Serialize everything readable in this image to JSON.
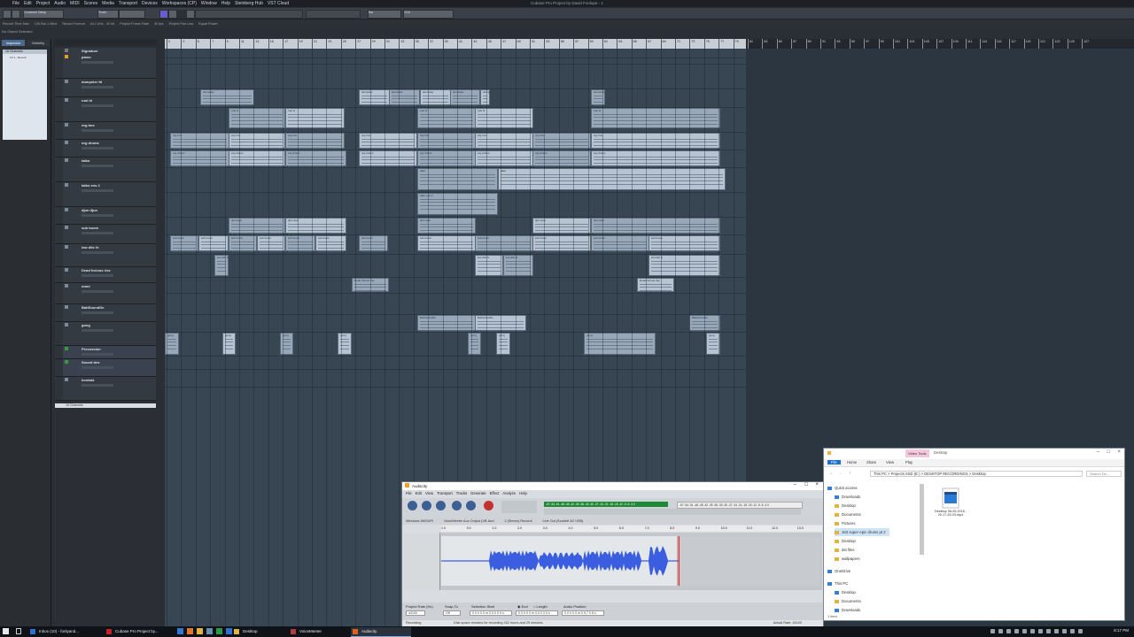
{
  "cubase": {
    "window_title": "Cubase Pro Project by David Fonlupe - 1",
    "menu": [
      "File",
      "Edit",
      "Project",
      "Audio",
      "MIDI",
      "Scores",
      "Media",
      "Transport",
      "Devices",
      "Workspaces (CP)",
      "Window",
      "Help",
      "Steinberg Hub",
      "VST Cloud"
    ],
    "toolbar": {
      "constrain": "Constrain Delay",
      "touch": "Touch",
      "grid": "Bar",
      "quantize": "1/16"
    },
    "infoline": [
      "Record Time Max",
      "126 Bar 1 Mins",
      "Record Format",
      "44.1 kHz - 32 bit",
      "Project Frame Rate",
      "30 fps",
      "Project Pan Law",
      "Equal Power"
    ],
    "selection_info": "No Object Selected",
    "inspector_tabs": [
      "Inspector",
      "Visibility"
    ],
    "inspector_heading": "16 Channels",
    "inspector_row": "FX 1 - Reverb",
    "channels_row": "16 Channels",
    "tracks": [
      {
        "name": "Signature",
        "color": "#7a7a7a"
      },
      {
        "name": "piano",
        "color": "#e0a020"
      },
      {
        "name": "dumpster fd",
        "color": "#7a8a9a"
      },
      {
        "name": "rust hi",
        "color": "#7a8a9a"
      },
      {
        "name": "org tms",
        "color": "#7a8a9a"
      },
      {
        "name": "org drums",
        "color": "#7a8a9a"
      },
      {
        "name": "taiko",
        "color": "#7a8a9a"
      },
      {
        "name": "taiko ens 2",
        "color": "#7a8a9a"
      },
      {
        "name": "djun djun",
        "color": "#7a8a9a"
      },
      {
        "name": "sub boom",
        "color": "#7a8a9a"
      },
      {
        "name": "low dtlc fx",
        "color": "#7a8a9a"
      },
      {
        "name": "Dead furious rise",
        "color": "#7a8a9a"
      },
      {
        "name": "omni",
        "color": "#7a8a9a"
      },
      {
        "name": "BattSoundDe",
        "color": "#7a8a9a"
      },
      {
        "name": "gong",
        "color": "#7a8a9a"
      },
      {
        "name": "Percussion",
        "color": "#3a9a40"
      },
      {
        "name": "Sound des",
        "color": "#3a9a40"
      },
      {
        "name": "kontakt",
        "color": "#7a8a9a"
      }
    ],
    "ruler_bars": [
      "1",
      "3",
      "5",
      "7",
      "9",
      "11",
      "13",
      "15",
      "17",
      "19",
      "21",
      "23",
      "25",
      "27",
      "29",
      "31",
      "33",
      "35",
      "37",
      "39",
      "41",
      "43",
      "45",
      "47",
      "49",
      "51",
      "53",
      "55",
      "57",
      "59",
      "61",
      "63",
      "65",
      "67",
      "69",
      "71",
      "73",
      "75",
      "77",
      "79"
    ],
    "ruler_bars_end": [
      "81",
      "83",
      "85",
      "87",
      "89",
      "91",
      "93",
      "95",
      "97",
      "99",
      "101",
      "103",
      "105",
      "107",
      "109",
      "111",
      "113",
      "115",
      "117",
      "119",
      "121",
      "123",
      "125",
      "127"
    ],
    "clips": [
      {
        "track": 2,
        "x0": "dumpster",
        "label": "dumpster"
      },
      {
        "track": 3,
        "label": "rust hi"
      },
      {
        "track": 4,
        "label": "org tms"
      },
      {
        "track": 5,
        "label": "org drums"
      },
      {
        "track": 6,
        "label": "taiko"
      },
      {
        "track": 7,
        "label": "taiko ens 2"
      },
      {
        "track": 8,
        "label": "djun djun"
      },
      {
        "track": 9,
        "label": "sub boom"
      },
      {
        "track": 10,
        "label": "low dtlc fx"
      },
      {
        "track": 11,
        "label": "Dead furious rise"
      },
      {
        "track": 13,
        "label": "BattSoundDe"
      },
      {
        "track": 14,
        "label": "gong"
      }
    ]
  },
  "audacity": {
    "title": "Audacity",
    "menu": [
      "File",
      "Edit",
      "View",
      "Transport",
      "Tracks",
      "Generate",
      "Effect",
      "Analyze",
      "Help"
    ],
    "meter_rec": "-57 -54 -51 -48 -45 -42 -39 -36 -33 -30 -27 -24 -21 -18 -15 -12 -9 -6 -3 0",
    "meter_play": "-57 -54 -51 -48 -45 -42 -39 -36 -33 -30 -27 -24 -21 -18 -15 -12 -9 -6 -3 0",
    "devices": [
      "Windows WASAPI",
      "VoiceMeeter Aux Output (VB-Aud",
      "2 (Stereo) Recordi",
      "Line Out (Scarlett 2i2 USB)"
    ],
    "ruler": [
      "1.0",
      "0.0",
      "1.0",
      "2.0",
      "3.0",
      "4.0",
      "5.0",
      "6.0",
      "7.0",
      "8.0",
      "9.0",
      "10.0",
      "11.0",
      "12.0",
      "13.0",
      "14.0",
      "15.0",
      "16.0"
    ],
    "project_rate_label": "Project Rate (Hz)",
    "project_rate": "44100",
    "snap_label": "Snap-To",
    "snap": "Off",
    "selection_start_label": "Selection Start",
    "selection_start": "0 0 h 0 0 m 0 0.0 0 0 s",
    "end_label": "End",
    "length_label": "Length",
    "selection_end": "0 0 h 0 0 m 0 0.0 0 0 s",
    "audio_position_label": "Audio Position",
    "audio_position": "0 0 h 0 0 m 0 9.7 0 8 s",
    "status_left": "Recording",
    "status_mid": "Disk space remains for recording 162 hours and 29 minutes.",
    "status_right": "Actual Rate: 44100"
  },
  "explorer": {
    "title": "Desktop",
    "video_tools": "Video Tools",
    "ribbon": [
      "File",
      "Home",
      "Share",
      "View",
      "Play"
    ],
    "path": "This PC  >  Projects SSD (E:)  >  DESKTOP RECORDINGS  >  Desktop",
    "search_placeholder": "Search De...",
    "nav": [
      {
        "label": "Quick access",
        "color": "#3a7bd5"
      },
      {
        "label": "Downloads",
        "color": "#3a7bd5"
      },
      {
        "label": "Desktop",
        "color": "#e3b341"
      },
      {
        "label": "Documents",
        "color": "#e3b341"
      },
      {
        "label": "Pictures",
        "color": "#e3b341"
      },
      {
        "label": "163 super epic drums pt 2",
        "color": "#e3b341"
      },
      {
        "label": "Desktop",
        "color": "#e3b341"
      },
      {
        "label": "dst files",
        "color": "#e3b341"
      },
      {
        "label": "wallpapers",
        "color": "#e3b341"
      },
      {
        "label": "OneDrive",
        "color": "#3a7bd5"
      },
      {
        "label": "This PC",
        "color": "#3a7bd5"
      },
      {
        "label": "Desktop",
        "color": "#3a7bd5"
      },
      {
        "label": "Documents",
        "color": "#e3b341"
      },
      {
        "label": "Downloads",
        "color": "#3a7bd5"
      }
    ],
    "file_name": "Desktop 06.05.2016 - 20.17.25.03.mp4",
    "status": "1 item"
  },
  "taskbar": {
    "items": [
      {
        "label": "Inbox (10) - fonlyand...",
        "color": "#2f6fd1"
      },
      {
        "label": "Cubase Pro Project by...",
        "color": "#c8202a"
      },
      {
        "label": "Desktop",
        "color": "#e3b341"
      },
      {
        "label": "VoiceMeeter",
        "color": "#b23b3b"
      },
      {
        "label": "Audacity",
        "color": "#e06020"
      }
    ],
    "clock": "8:17 PM"
  }
}
